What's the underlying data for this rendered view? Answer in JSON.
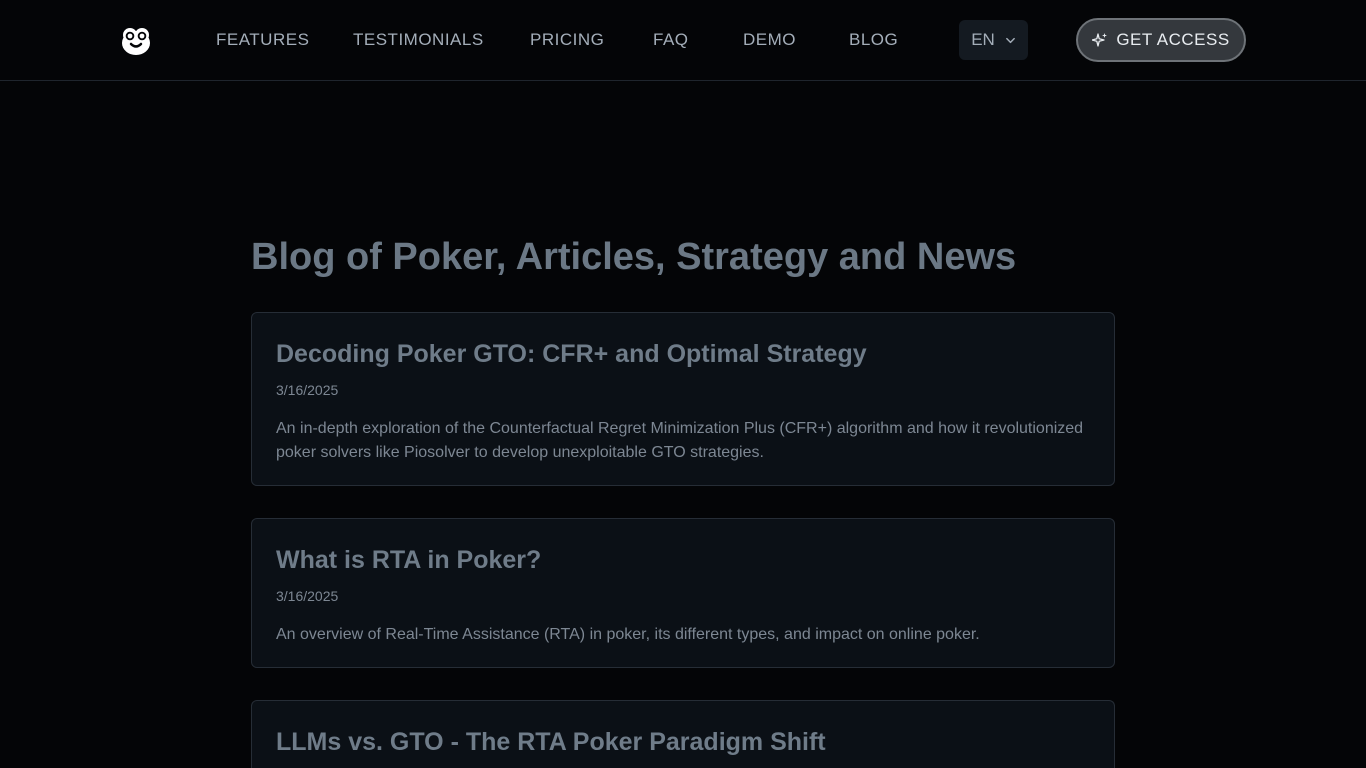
{
  "header": {
    "logo_name": "owl-logo",
    "nav": [
      {
        "label": "FEATURES"
      },
      {
        "label": "TESTIMONIALS"
      },
      {
        "label": "PRICING"
      },
      {
        "label": "FAQ"
      },
      {
        "label": "DEMO"
      },
      {
        "label": "BLOG"
      }
    ],
    "language": "EN",
    "cta_label": "GET ACCESS"
  },
  "main": {
    "title": "Blog of Poker, Articles, Strategy and News",
    "posts": [
      {
        "title": "Decoding Poker GTO: CFR+ and Optimal Strategy",
        "date": "3/16/2025",
        "description": "An in-depth exploration of the Counterfactual Regret Minimization Plus (CFR+) algorithm and how it revolutionized poker solvers like Piosolver to develop unexploitable GTO strategies."
      },
      {
        "title": "What is RTA in Poker?",
        "date": "3/16/2025",
        "description": "An overview of Real-Time Assistance (RTA) in poker, its different types, and impact on online poker."
      },
      {
        "title": "LLMs vs. GTO - The RTA Poker Paradigm Shift",
        "date": "",
        "description": ""
      }
    ]
  },
  "colors": {
    "background": "#040507",
    "card_background": "#0b1016",
    "card_border": "#262d36",
    "title": "#6b7885",
    "cta_background": "#34383d"
  }
}
